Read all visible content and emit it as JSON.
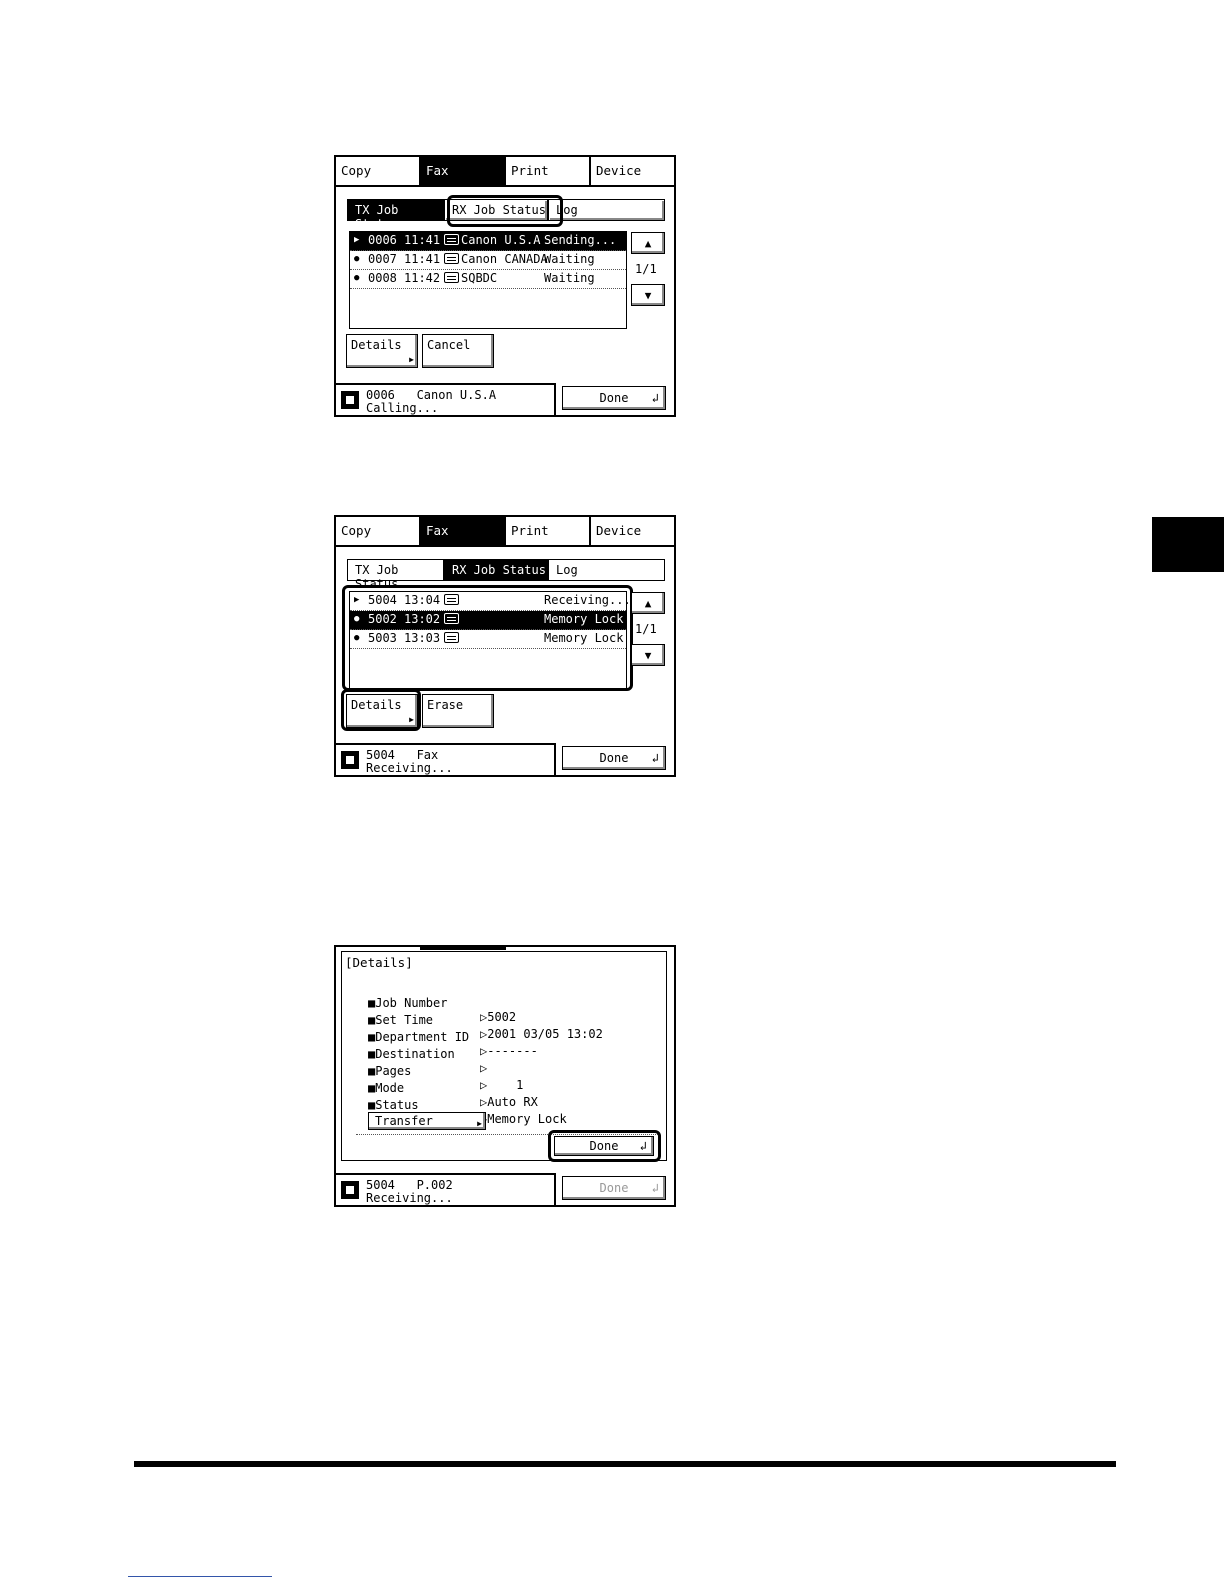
{
  "tabs": [
    "Copy",
    "Fax",
    "Print",
    "Device"
  ],
  "selected_tab": "Fax",
  "subtabs": [
    "TX Job Status",
    "RX Job Status",
    "Log"
  ],
  "panel1": {
    "rows": [
      {
        "marker": "▶",
        "no": "0006",
        "time": "11:41",
        "name": "Canon U.S.A",
        "status": "Sending..."
      },
      {
        "marker": "●",
        "no": "0007",
        "time": "11:41",
        "name": "Canon CANADA",
        "status": "Waiting"
      },
      {
        "marker": "●",
        "no": "0008",
        "time": "11:42",
        "name": "SQBDC",
        "status": "Waiting"
      }
    ],
    "page": "1/1",
    "btn_details": "Details",
    "btn_second": "Cancel",
    "status_line1": "0006   Canon U.S.A",
    "status_line2": "Calling...",
    "done": "Done"
  },
  "panel2": {
    "rows": [
      {
        "marker": "▶",
        "no": "5004",
        "time": "13:04",
        "name": "",
        "status": "Receiving..."
      },
      {
        "marker": "●",
        "no": "5002",
        "time": "13:02",
        "name": "",
        "status": "Memory Lock"
      },
      {
        "marker": "●",
        "no": "5003",
        "time": "13:03",
        "name": "",
        "status": "Memory Lock"
      }
    ],
    "page": "1/1",
    "btn_details": "Details",
    "btn_second": "Erase",
    "status_line1": "5004   Fax",
    "status_line2": "Receiving...",
    "done": "Done"
  },
  "panel3": {
    "title": "[Details]",
    "fields": [
      {
        "label": "■Job Number",
        "value": "▷5002"
      },
      {
        "label": "■Set Time",
        "value": "▷2001 03/05 13:02"
      },
      {
        "label": "■Department ID",
        "value": "▷-------"
      },
      {
        "label": "■Destination",
        "value": "▷"
      },
      {
        "label": "■Pages",
        "value": "▷    1"
      },
      {
        "label": "■Mode",
        "value": "▷Auto RX"
      },
      {
        "label": "■Status",
        "value": "▷Memory Lock"
      }
    ],
    "transfer": "Transfer",
    "done": "Done",
    "status_line1": "5004   P.002",
    "status_line2": "Receiving...",
    "outer_done": "Done"
  },
  "icons": {
    "fax_job": "fax-icon",
    "up": "up-arrow-icon",
    "down": "down-arrow-icon",
    "return": "return-icon"
  }
}
